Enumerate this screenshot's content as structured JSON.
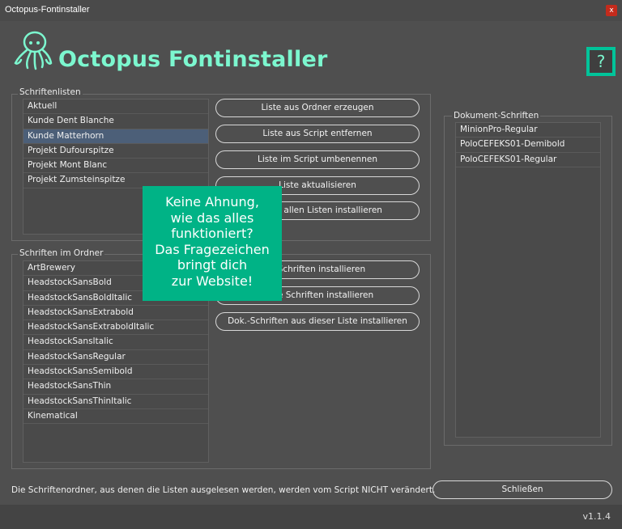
{
  "window": {
    "title": "Octopus-Fontinstaller",
    "close_label": "x"
  },
  "header": {
    "app_title": "Octopus Fontinstaller",
    "help_label": "?"
  },
  "groups": {
    "font_lists": {
      "label": "Schriftenlisten",
      "items": [
        "Aktuell",
        "Kunde Dent Blanche",
        "Kunde Matterhorn",
        "Projekt Dufourspitze",
        "Projekt Mont Blanc",
        "Projekt Zumsteinspitze"
      ],
      "selected": "Kunde Matterhorn"
    },
    "folder_fonts": {
      "label": "Schriften im Ordner",
      "items": [
        "ArtBrewery",
        "HeadstockSansBold",
        "HeadstockSansBoldItalic",
        "HeadstockSansExtrabold",
        "HeadstockSansExtraboldItalic",
        "HeadstockSansItalic",
        "HeadstockSansRegular",
        "HeadstockSansSemibold",
        "HeadstockSansThin",
        "HeadstockSansThinItalic",
        "Kinematical"
      ]
    },
    "document_fonts": {
      "label": "Dokument-Schriften",
      "items": [
        "MinionPro-Regular",
        "PoloCEFEKS01-Demibold",
        "PoloCEFEKS01-Regular"
      ]
    }
  },
  "list_buttons": [
    "Liste aus Ordner erzeugen",
    "Liste aus Script entfernen",
    "Liste im Script umbenennen",
    "Liste aktualisieren",
    "en aus allen Listen installieren"
  ],
  "folder_buttons": [
    "e Schriften installieren",
    "ählte Schriften installieren",
    "Dok.-Schriften aus dieser Liste installieren"
  ],
  "tooltip": {
    "lines": [
      "Keine Ahnung,",
      "wie das alles",
      "funktioniert?",
      "Das Fragezeichen",
      "bringt dich",
      "zur Website!"
    ]
  },
  "footer": {
    "note": "Die Schriftenordner, aus denen die Listen ausgelesen werden, werden vom Script NICHT verändert.",
    "close_button": "Schließen",
    "version": "v1.1.4"
  },
  "colors": {
    "accent": "#7cf7cf",
    "tooltip_bg": "#00b386",
    "help_border": "#00c49a",
    "selected_row": "#4c5f78"
  }
}
